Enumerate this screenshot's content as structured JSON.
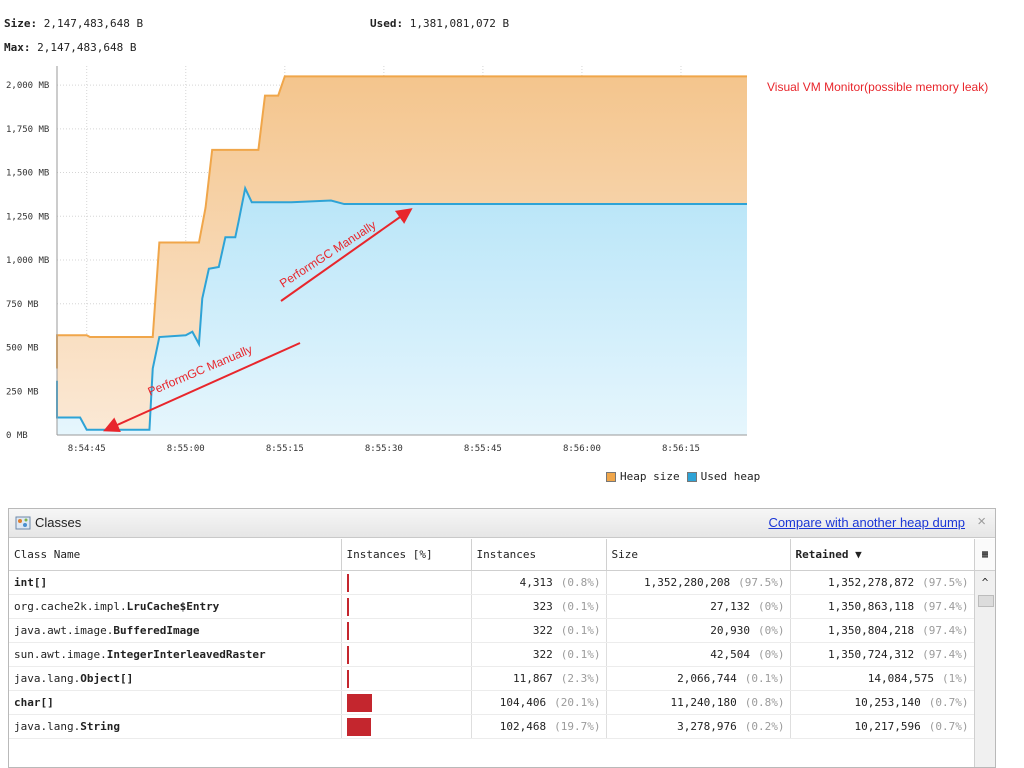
{
  "header": {
    "size_label": "Size:",
    "size_value": "2,147,483,648 B",
    "used_label": "Used:",
    "used_value": "1,381,081,072 B",
    "max_label": "Max:",
    "max_value": "2,147,483,648 B"
  },
  "annotation_title": "Visual VM Monitor(possible memory leak)",
  "arrow_labels": [
    "PerformGC Manually",
    "PerformGC Manually"
  ],
  "legend": [
    {
      "label": "Heap size",
      "color": "#f0a64a"
    },
    {
      "label": "Used heap",
      "color": "#2ea3d6"
    }
  ],
  "chart_data": {
    "type": "area",
    "y_unit": "MB",
    "ylim": [
      0,
      2100
    ],
    "y_ticks": [
      "0 MB",
      "250 MB",
      "500 MB",
      "750 MB",
      "1,000 MB",
      "1,250 MB",
      "1,500 MB",
      "1,750 MB",
      "2,000 MB"
    ],
    "x_ticks": [
      "8:54:45",
      "8:55:00",
      "8:55:15",
      "8:55:30",
      "8:55:45",
      "8:56:00",
      "8:56:15"
    ],
    "series": [
      {
        "name": "Heap size",
        "color": "#f0a64a",
        "points": [
          [
            -7,
            380
          ],
          [
            -6,
            570
          ],
          [
            0,
            570
          ],
          [
            0.5,
            560
          ],
          [
            10,
            560
          ],
          [
            11,
            1100
          ],
          [
            17,
            1100
          ],
          [
            18,
            1300
          ],
          [
            19,
            1630
          ],
          [
            26,
            1630
          ],
          [
            27,
            1940
          ],
          [
            29,
            1940
          ],
          [
            30,
            2050
          ],
          [
            100,
            2050
          ]
        ]
      },
      {
        "name": "Used heap",
        "color": "#2ea3d6",
        "points": [
          [
            -7,
            310
          ],
          [
            -6,
            100
          ],
          [
            -1,
            100
          ],
          [
            0,
            30
          ],
          [
            9.5,
            30
          ],
          [
            10,
            380
          ],
          [
            11,
            560
          ],
          [
            15,
            570
          ],
          [
            16,
            590
          ],
          [
            17,
            520
          ],
          [
            17.5,
            780
          ],
          [
            18.5,
            950
          ],
          [
            20,
            960
          ],
          [
            21,
            1130
          ],
          [
            22.5,
            1130
          ],
          [
            23,
            1220
          ],
          [
            24,
            1410
          ],
          [
            25,
            1330
          ],
          [
            31,
            1330
          ],
          [
            37,
            1340
          ],
          [
            39,
            1320
          ],
          [
            100,
            1320
          ]
        ]
      }
    ]
  },
  "panel": {
    "title": "Classes",
    "compare_link": "Compare with another heap dump",
    "close_label": "×",
    "columns": [
      "Class Name",
      "Instances [%]",
      "Instances",
      "Size",
      "Retained ▼"
    ],
    "rows": [
      {
        "name_prefix": "",
        "name_bold": "int[]",
        "inst_pct": 0.8,
        "instances": "4,313",
        "instances_pct": "(0.8%)",
        "size": "1,352,280,208",
        "size_pct": "(97.5%)",
        "retained": "1,352,278,872",
        "retained_pct": "(97.5%)"
      },
      {
        "name_prefix": "org.cache2k.impl.",
        "name_bold": "LruCache$Entry",
        "inst_pct": 0.1,
        "instances": "323",
        "instances_pct": "(0.1%)",
        "size": "27,132",
        "size_pct": "(0%)",
        "retained": "1,350,863,118",
        "retained_pct": "(97.4%)"
      },
      {
        "name_prefix": "java.awt.image.",
        "name_bold": "BufferedImage",
        "inst_pct": 0.1,
        "instances": "322",
        "instances_pct": "(0.1%)",
        "size": "20,930",
        "size_pct": "(0%)",
        "retained": "1,350,804,218",
        "retained_pct": "(97.4%)"
      },
      {
        "name_prefix": "sun.awt.image.",
        "name_bold": "IntegerInterleavedRaster",
        "inst_pct": 0.1,
        "instances": "322",
        "instances_pct": "(0.1%)",
        "size": "42,504",
        "size_pct": "(0%)",
        "retained": "1,350,724,312",
        "retained_pct": "(97.4%)"
      },
      {
        "name_prefix": "java.lang.",
        "name_bold": "Object[]",
        "inst_pct": 2.3,
        "instances": "11,867",
        "instances_pct": "(2.3%)",
        "size": "2,066,744",
        "size_pct": "(0.1%)",
        "retained": "14,084,575",
        "retained_pct": "(1%)"
      },
      {
        "name_prefix": "",
        "name_bold": "char[]",
        "inst_pct": 20.1,
        "instances": "104,406",
        "instances_pct": "(20.1%)",
        "size": "11,240,180",
        "size_pct": "(0.8%)",
        "retained": "10,253,140",
        "retained_pct": "(0.7%)"
      },
      {
        "name_prefix": "java.lang.",
        "name_bold": "String",
        "inst_pct": 19.7,
        "instances": "102,468",
        "instances_pct": "(19.7%)",
        "size": "3,278,976",
        "size_pct": "(0.2%)",
        "retained": "10,217,596",
        "retained_pct": "(0.7%)"
      }
    ]
  }
}
